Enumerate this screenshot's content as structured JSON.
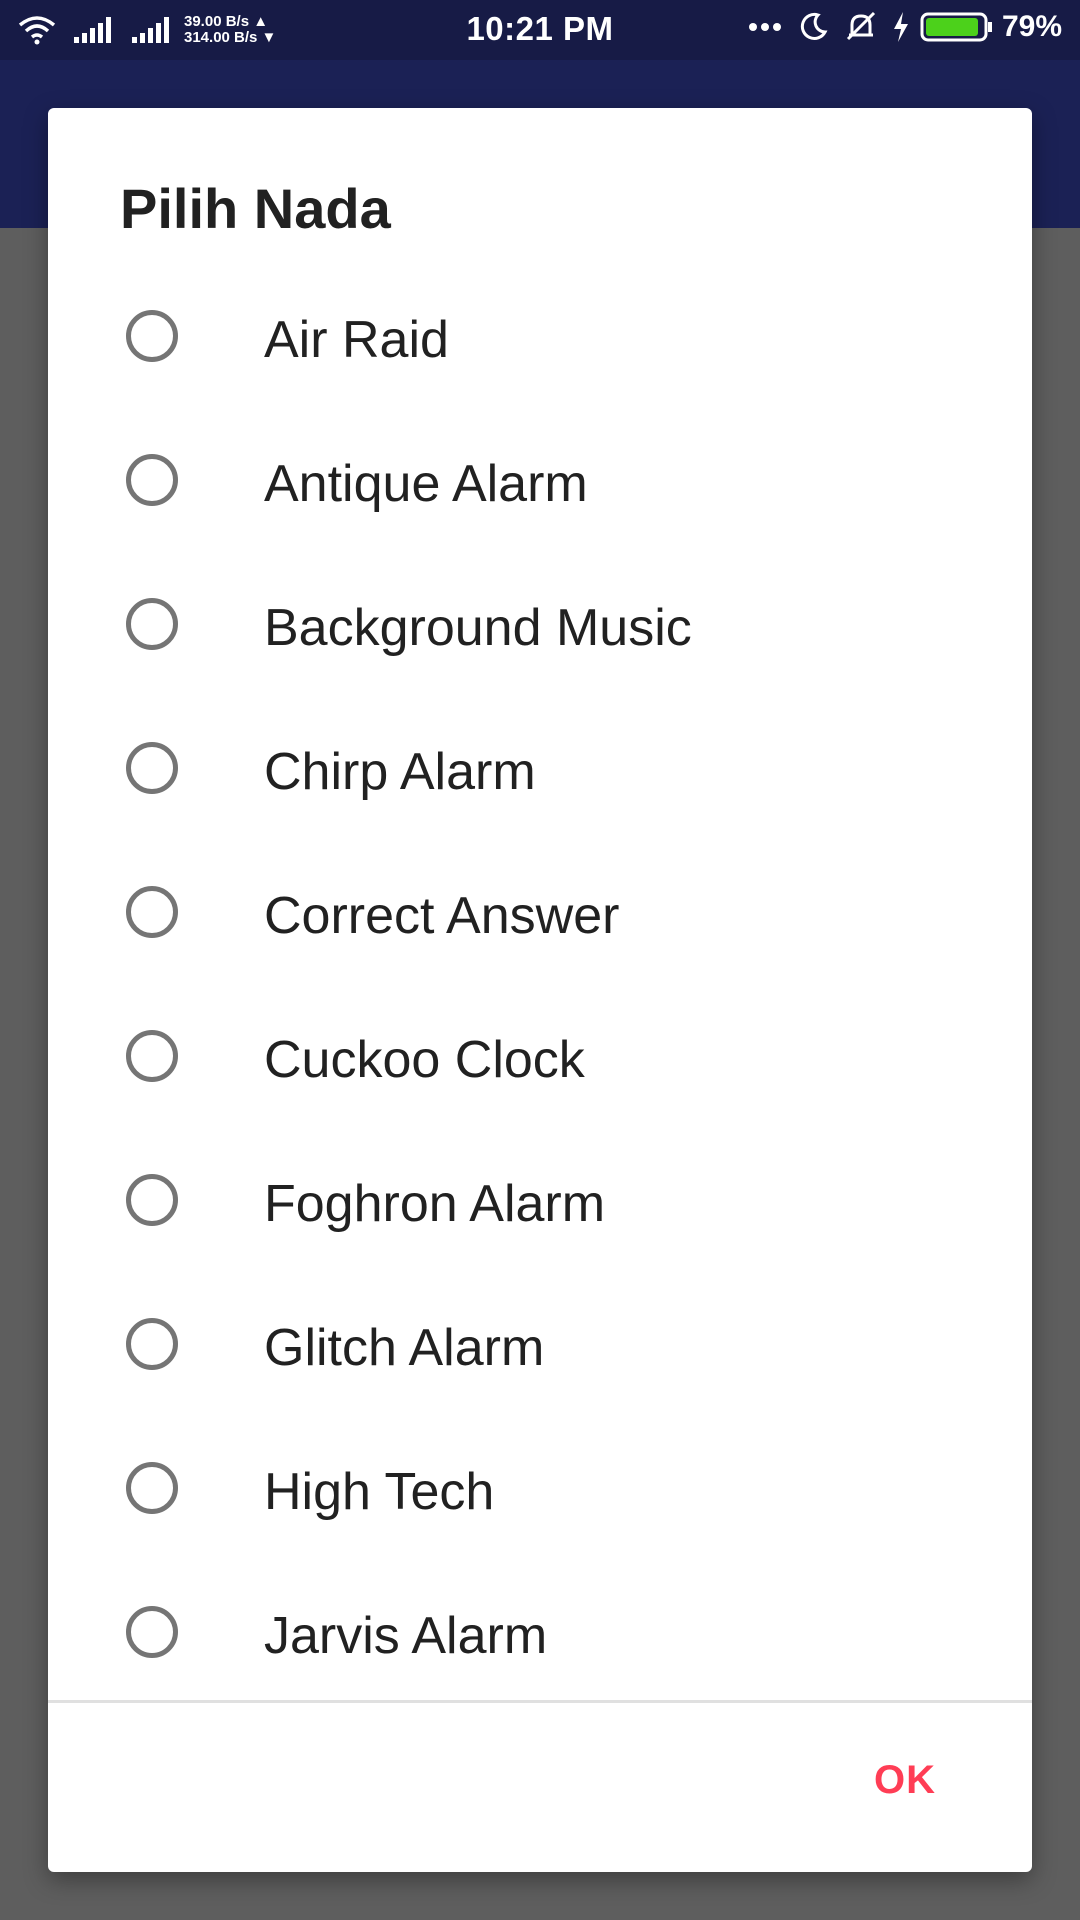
{
  "status_bar": {
    "time": "10:21 PM",
    "net_up": "39.00 B/s",
    "net_down": "314.00 B/s",
    "battery": "79%",
    "icons": [
      "wifi-icon",
      "signal-icon",
      "signal-icon",
      "more-icon",
      "moon-icon",
      "mute-icon",
      "charging-icon",
      "battery-icon"
    ],
    "battery_color": "#4cd11b"
  },
  "dialog": {
    "title": "Pilih Nada",
    "options": [
      {
        "label": "Air Raid"
      },
      {
        "label": "Antique Alarm"
      },
      {
        "label": "Background Music"
      },
      {
        "label": "Chirp Alarm"
      },
      {
        "label": "Correct Answer"
      },
      {
        "label": "Cuckoo Clock"
      },
      {
        "label": "Foghron Alarm"
      },
      {
        "label": "Glitch Alarm"
      },
      {
        "label": "High Tech"
      },
      {
        "label": "Jarvis Alarm"
      }
    ],
    "ok_label": "OK",
    "accent_color": "#ff3d55"
  }
}
